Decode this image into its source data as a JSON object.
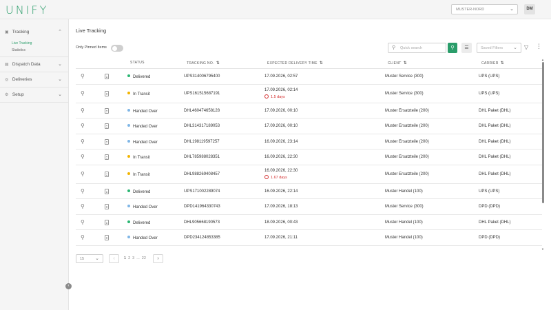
{
  "app": {
    "logo": "UNIFY"
  },
  "header": {
    "location": "MUSTER-NORD",
    "avatar": "DM"
  },
  "sidebar": {
    "groups": [
      {
        "label": "Tracking",
        "icon": "truck-icon",
        "open": true,
        "items": [
          {
            "label": "Live Tracking",
            "active": true
          },
          {
            "label": "Statistics",
            "active": false
          }
        ]
      },
      {
        "label": "Dispatch Data",
        "icon": "box-icon"
      },
      {
        "label": "Deliveries",
        "icon": "globe-icon"
      },
      {
        "label": "Setup",
        "icon": "gear-icon"
      }
    ]
  },
  "page": {
    "title": "Live Tracking"
  },
  "toolbar": {
    "pinned_label": "Only Pinned Items",
    "pinned_on": false,
    "search_placeholder": "Quick search",
    "saved_filters_placeholder": "Saved Filters"
  },
  "table": {
    "columns": {
      "status": "STATUS",
      "tracking": "TRACKING NO.",
      "expected": "EXPECTED DELIVERY TIME",
      "client": "CLIENT",
      "carrier": "CARRIER"
    },
    "status_colors": {
      "Delivered": "#2bb673",
      "In Transit": "#f2b400",
      "Handed Over": "#7fb6e6"
    },
    "rows": [
      {
        "status": "Delivered",
        "tracking": "UPS314006795400",
        "expected": "17.09.2026, 02:57",
        "late": "",
        "client": "Muster Service (300)",
        "carrier": "UPS (UPS)"
      },
      {
        "status": "In Transit",
        "tracking": "UPS161515687191",
        "expected": "17.09.2026, 02:14",
        "late": "1.5 days",
        "client": "Muster Service (300)",
        "carrier": "UPS (UPS)"
      },
      {
        "status": "Handed Over",
        "tracking": "DHL460474658128",
        "expected": "17.09.2026, 00:10",
        "late": "",
        "client": "Muster Ersatzteile (200)",
        "carrier": "DHL Paket (DHL)"
      },
      {
        "status": "Handed Over",
        "tracking": "DHL314317189053",
        "expected": "17.09.2026, 00:10",
        "late": "",
        "client": "Muster Ersatzteile (200)",
        "carrier": "DHL Paket (DHL)"
      },
      {
        "status": "Handed Over",
        "tracking": "DHL198119597257",
        "expected": "16.09.2026, 23:14",
        "late": "",
        "client": "Muster Ersatzteile (200)",
        "carrier": "DHL Paket (DHL)"
      },
      {
        "status": "In Transit",
        "tracking": "DHL785988028351",
        "expected": "16.09.2026, 22:30",
        "late": "",
        "client": "Muster Ersatzteile (200)",
        "carrier": "DHL Paket (DHL)"
      },
      {
        "status": "In Transit",
        "tracking": "DHL988269408457",
        "expected": "16.09.2026, 22:30",
        "late": "1.67 days",
        "client": "Muster Ersatzteile (200)",
        "carrier": "DHL Paket (DHL)"
      },
      {
        "status": "Delivered",
        "tracking": "UPS171002289074",
        "expected": "16.09.2026, 22:14",
        "late": "",
        "client": "Muster Handel (100)",
        "carrier": "UPS (UPS)"
      },
      {
        "status": "Handed Over",
        "tracking": "DPD141964330743",
        "expected": "17.09.2026, 18:13",
        "late": "",
        "client": "Muster Service (300)",
        "carrier": "DPD (DPD)"
      },
      {
        "status": "Delivered",
        "tracking": "DHL905668190573",
        "expected": "18.09.2026, 00:43",
        "late": "",
        "client": "Muster Handel (100)",
        "carrier": "DHL Paket (DHL)"
      },
      {
        "status": "Handed Over",
        "tracking": "DPD234124853385",
        "expected": "17.09.2026, 21:11",
        "late": "",
        "client": "Muster Handel (100)",
        "carrier": "DPD (DPD)"
      }
    ]
  },
  "pagination": {
    "page_size": "15",
    "pages": [
      "1",
      "2",
      "3",
      "...",
      "22"
    ],
    "current": "1"
  }
}
